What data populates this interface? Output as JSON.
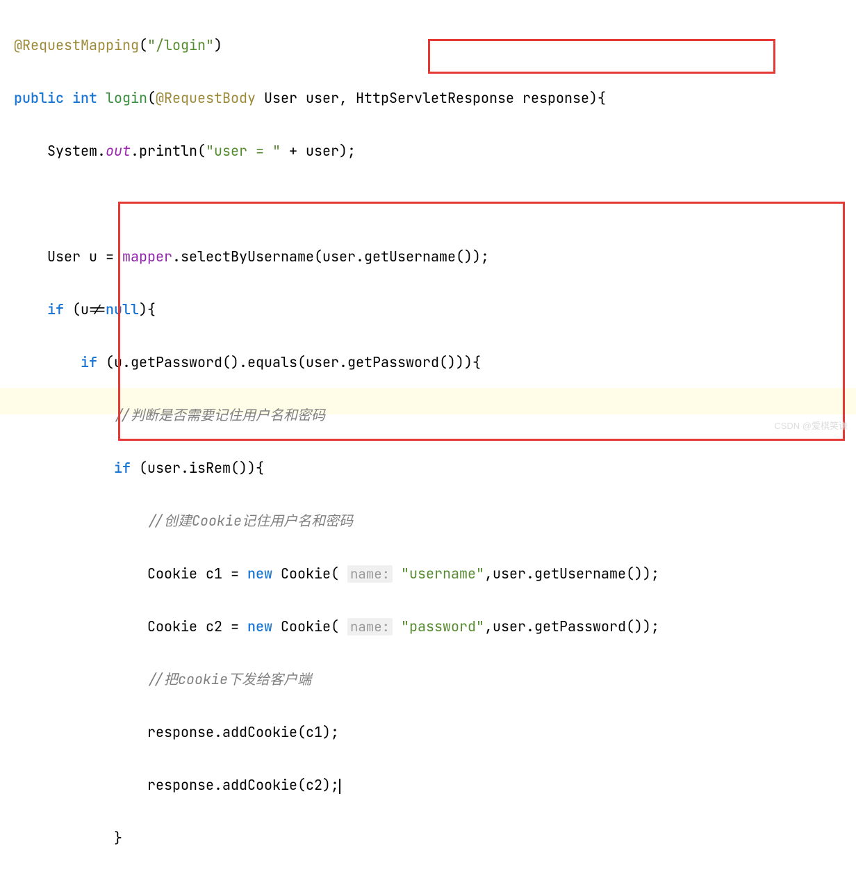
{
  "code": {
    "line1": {
      "annotation": "@RequestMapping",
      "paren_open": "(",
      "string": "\"/login\"",
      "paren_close": ")"
    },
    "line2": {
      "kw_public": "public",
      "kw_int": "int",
      "method": "login",
      "paren_open": "(",
      "annotation": "@RequestBody",
      "type1": "User",
      "param1": "user",
      "comma": ",",
      "type2": "HttpServletResponse",
      "param2": "response",
      "paren_close_brace": "){"
    },
    "line3": {
      "indent": "    ",
      "sys": "System",
      "dot1": ".",
      "out": "out",
      "dot2": ".",
      "println": "println",
      "paren_open": "(",
      "string": "\"user = \"",
      "plus": " + ",
      "var": "user",
      "close": ");"
    },
    "line4": "",
    "line5": {
      "indent": "    ",
      "type": "User",
      "var": "u",
      "eq": " = ",
      "mapper": "mapper",
      "dot": ".",
      "method": "selectByUsername",
      "paren_open": "(",
      "arg": "user",
      "dot2": ".",
      "getUsername": "getUsername",
      "close": "());"
    },
    "line6": {
      "indent": "    ",
      "kw_if": "if",
      "cond": " (u!=",
      "kw_null": "null",
      "close": "){"
    },
    "line7": {
      "indent": "        ",
      "kw_if": "if",
      "open": " (",
      "u": "u",
      "dot1": ".",
      "getPassword": "getPassword",
      "mid": "().",
      "equals": "equals",
      "open2": "(",
      "user": "user",
      "dot2": ".",
      "getPassword2": "getPassword",
      "close": "())){"
    },
    "line8": {
      "indent": "            ",
      "comment": "//判断是否需要记住用户名和密码"
    },
    "line9": {
      "indent": "            ",
      "kw_if": "if",
      "open": " (",
      "user": "user",
      "dot": ".",
      "isRem": "isRem",
      "close": "()){"
    },
    "line10": {
      "indent": "                ",
      "comment": "//创建Cookie记住用户名和密码"
    },
    "line11": {
      "indent": "                ",
      "type": "Cookie",
      "var": "c1",
      "eq": " = ",
      "kw_new": "new",
      "sp": " ",
      "ctor": "Cookie",
      "open": "( ",
      "hint": "name:",
      "sp2": " ",
      "string": "\"username\"",
      "comma": ",",
      "user": "user",
      "dot": ".",
      "getUsername": "getUsername",
      "close": "());"
    },
    "line12": {
      "indent": "                ",
      "type": "Cookie",
      "var": "c2",
      "eq": " = ",
      "kw_new": "new",
      "sp": " ",
      "ctor": "Cookie",
      "open": "( ",
      "hint": "name:",
      "sp2": " ",
      "string": "\"password\"",
      "comma": ",",
      "user": "user",
      "dot": ".",
      "getPassword": "getPassword",
      "close": "());"
    },
    "line13": {
      "indent": "                ",
      "comment": "//把cookie下发给客户端"
    },
    "line14": {
      "indent": "                ",
      "response": "response",
      "dot": ".",
      "addCookie": "addCookie",
      "open": "(",
      "arg": "c1",
      "close": ");"
    },
    "line15": {
      "indent": "                ",
      "response": "response",
      "dot": ".",
      "addCookie": "addCookie",
      "open": "(",
      "arg": "c2",
      "close": ");"
    },
    "line16": {
      "indent": "            ",
      "brace": "}"
    }
  },
  "watermark": "CSDN @爱棋笑谦"
}
